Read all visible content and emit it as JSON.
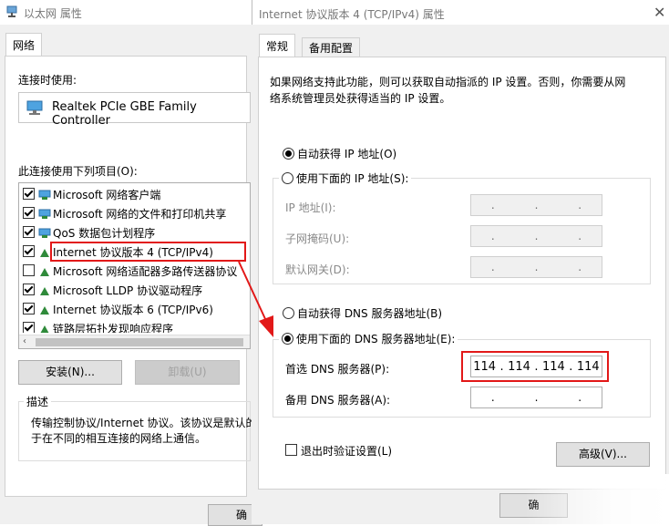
{
  "left_window": {
    "title": "以太网 属性",
    "tab": "网络",
    "connect_using_label": "连接时使用:",
    "adapter_name": "Realtek PCIe GBE Family Controller",
    "items_label": "此连接使用下列项目(O):",
    "items": [
      {
        "label": "Microsoft 网络客户端",
        "checked": true,
        "icon": "network-client-icon"
      },
      {
        "label": "Microsoft 网络的文件和打印机共享",
        "checked": true,
        "icon": "file-sharing-icon"
      },
      {
        "label": "QoS 数据包计划程序",
        "checked": true,
        "icon": "qos-icon"
      },
      {
        "label": "Internet 协议版本 4 (TCP/IPv4)",
        "checked": true,
        "icon": "protocol-icon"
      },
      {
        "label": "Microsoft 网络适配器多路传送器协议",
        "checked": false,
        "icon": "protocol-icon"
      },
      {
        "label": "Microsoft LLDP 协议驱动程序",
        "checked": true,
        "icon": "protocol-icon"
      },
      {
        "label": "Internet 协议版本 6 (TCP/IPv6)",
        "checked": true,
        "icon": "protocol-icon"
      },
      {
        "label": "链路层拓扑发现响应程序",
        "checked": true,
        "icon": "protocol-icon"
      }
    ],
    "install_button": "安装(N)...",
    "uninstall_button": "卸载(U)",
    "description_label": "描述",
    "description_line1": "传输控制协议/Internet 协议。该协议是默认的",
    "description_line2": "于在不同的相互连接的网络上通信。",
    "ok_button_partial": "确"
  },
  "right_window": {
    "title": "Internet 协议版本 4 (TCP/IPv4) 属性",
    "tabs": [
      "常规",
      "备用配置"
    ],
    "intro_line1": "如果网络支持此功能，则可以获取自动指派的 IP 设置。否则，你需要从网",
    "intro_line2": "络系统管理员处获得适当的 IP 设置。",
    "auto_ip": "自动获得 IP 地址(O)",
    "manual_ip": "使用下面的 IP 地址(S):",
    "ip_address_label": "IP 地址(I):",
    "subnet_label": "子网掩码(U):",
    "gateway_label": "默认网关(D):",
    "empty_ip": [
      ".",
      ".",
      "."
    ],
    "auto_dns": "自动获得 DNS 服务器地址(B)",
    "manual_dns": "使用下面的 DNS 服务器地址(E):",
    "preferred_dns_label": "首选 DNS 服务器(P):",
    "preferred_dns_octets": [
      "114",
      ".",
      "114",
      ".",
      "114",
      ".",
      "114"
    ],
    "alternate_dns_label": "备用 DNS 服务器(A):",
    "validate_on_exit": "退出时验证设置(L)",
    "advanced_button": "高级(V)...",
    "ok_button_partial": "确"
  },
  "colors": {
    "highlight_red": "#e21818",
    "window_bg": "#f0f0f0"
  }
}
